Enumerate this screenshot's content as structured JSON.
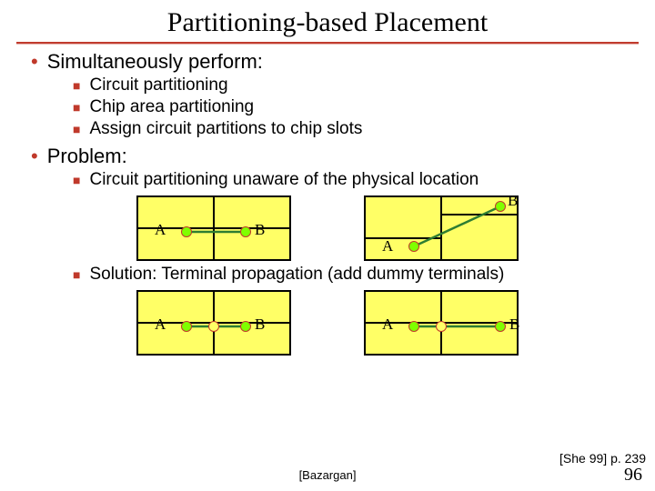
{
  "title": "Partitioning-based Placement",
  "b1": {
    "heading": "Simultaneously perform:",
    "items": [
      "Circuit partitioning",
      "Chip area partitioning",
      "Assign circuit partitions to chip slots"
    ]
  },
  "b2": {
    "heading": "Problem:",
    "items": [
      "Circuit partitioning unaware of the physical location",
      "Solution: Terminal propagation (add dummy terminals)"
    ]
  },
  "labels": {
    "A": "A",
    "B": "B"
  },
  "foot": {
    "ref": "[She 99] p. 239",
    "center": "[Bazargan]",
    "page": "96"
  }
}
